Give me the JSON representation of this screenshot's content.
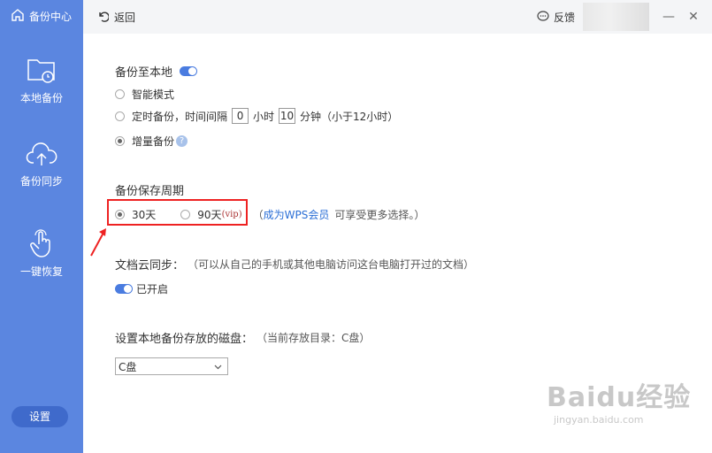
{
  "sidebar": {
    "brand": "备份中心",
    "items": [
      {
        "label": "本地备份",
        "icon": "folder-clock-icon"
      },
      {
        "label": "备份同步",
        "icon": "cloud-upload-icon"
      },
      {
        "label": "一键恢复",
        "icon": "tap-hand-icon"
      }
    ],
    "settings_label": "设置",
    "color": "#5b86e0"
  },
  "topbar": {
    "back_label": "返回",
    "feedback_label": "反馈"
  },
  "backup_local": {
    "title": "备份至本地",
    "enabled": true,
    "options": {
      "smart": "智能模式",
      "timed_prefix": "定时备份，时间间隔",
      "hours_value": "0",
      "hours_unit": "小时",
      "minutes_value": "10",
      "minutes_unit": "分钟（小于12小时）",
      "incremental": "增量备份",
      "selected": "incremental"
    }
  },
  "retention": {
    "title": "备份保存周期",
    "option_30": "30天",
    "option_90": "90天",
    "vip_tag": "(vip)",
    "note_open": "（",
    "member_link": "成为WPS会员",
    "note_rest": "可享受更多选择。）",
    "selected": "30"
  },
  "cloud_sync": {
    "title": "文档云同步：",
    "description": "（可以从自己的手机或其他电脑访问这台电脑打开过的文档）",
    "status": "已开启"
  },
  "disk": {
    "title": "设置本地备份存放的磁盘：",
    "current": "（当前存放目录：C盘）",
    "selected": "C盘"
  },
  "watermark": {
    "main": "Baidu经验",
    "sub": "jingyan.baidu.com"
  },
  "colors": {
    "accent": "#4a7ce0",
    "highlight": "#e22222",
    "link": "#2b6fd6"
  }
}
